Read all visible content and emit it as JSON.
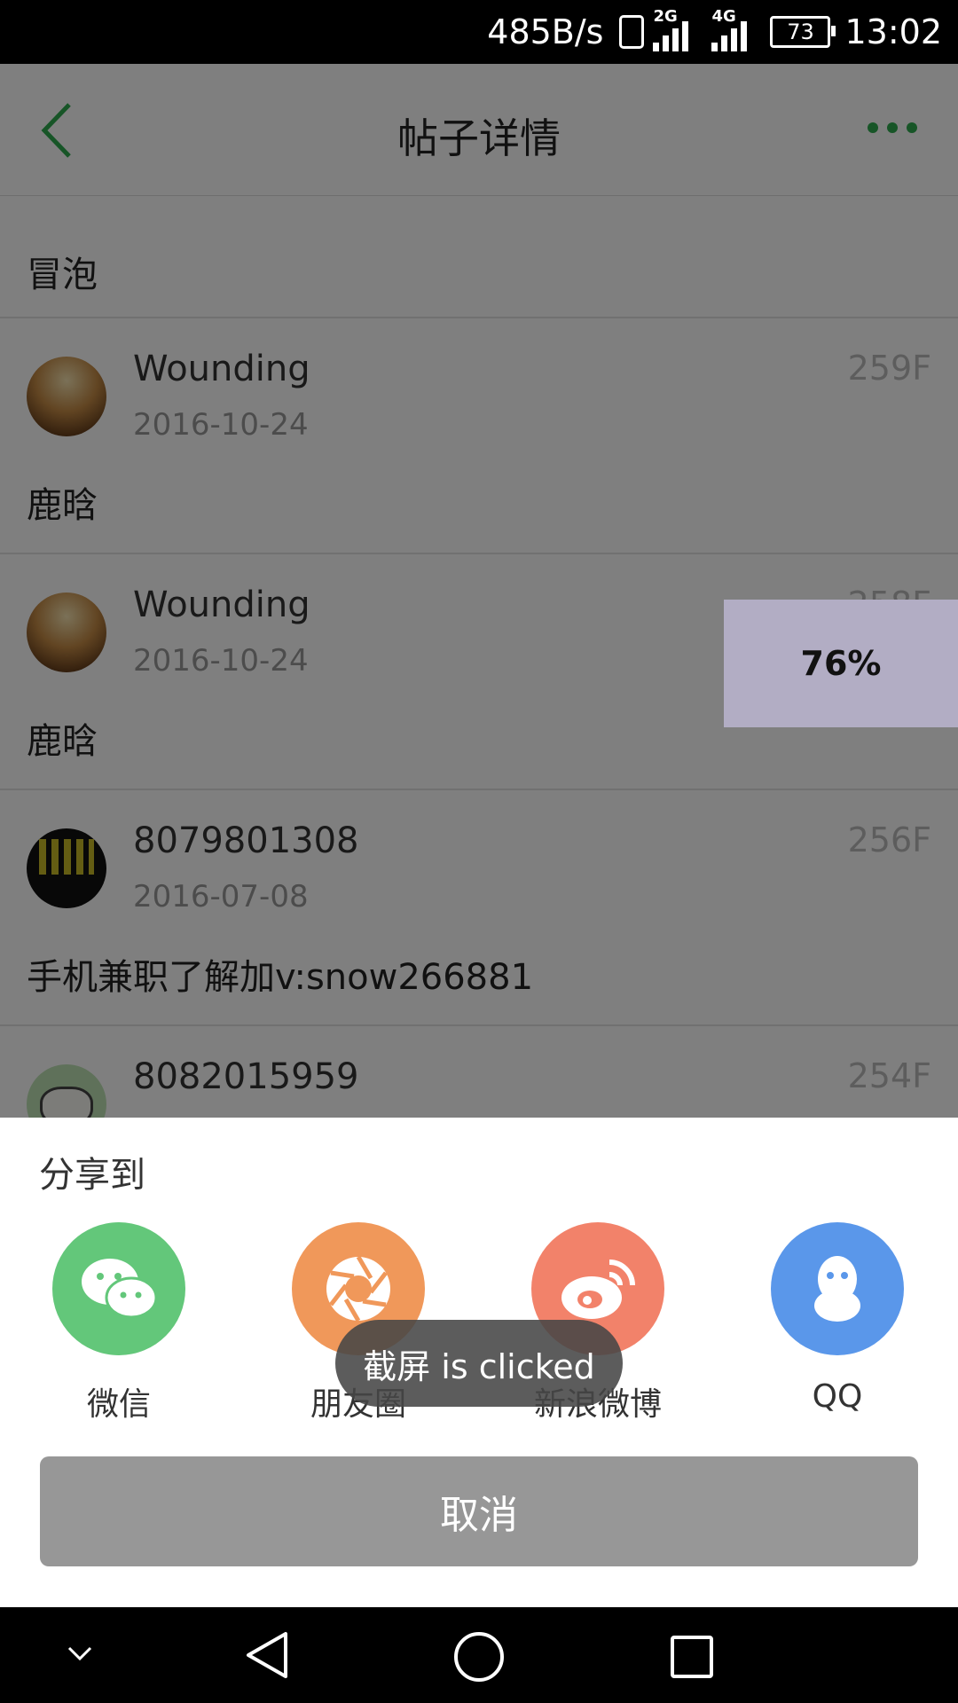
{
  "status_bar": {
    "net_speed": "485B/s",
    "sig1_label": "2G",
    "sig2_label": "4G",
    "battery": "73",
    "time": "13:02"
  },
  "header": {
    "title": "帖子详情"
  },
  "posts": [
    {
      "content": "冒泡"
    },
    {
      "username": "Wounding",
      "date": "2016-10-24",
      "floor": "259F",
      "content": "鹿晗"
    },
    {
      "username": "Wounding",
      "date": "2016-10-24",
      "floor": "258F",
      "content": "鹿晗"
    },
    {
      "username": "8079801308",
      "date": "2016-07-08",
      "floor": "256F",
      "content": "手机兼职了解加v:snow266881"
    },
    {
      "username": "8082015959",
      "floor": "254F"
    }
  ],
  "progress": {
    "value": 76,
    "label": "76%"
  },
  "share_sheet": {
    "title": "分享到",
    "items": [
      {
        "label": "微信",
        "icon": "wechat-icon",
        "color": "#63c77a"
      },
      {
        "label": "朋友圈",
        "icon": "moments-icon",
        "color": "#f0985a"
      },
      {
        "label": "新浪微博",
        "icon": "weibo-icon",
        "color": "#f2826a"
      },
      {
        "label": "QQ",
        "icon": "qq-icon",
        "color": "#5a97ea"
      }
    ],
    "cancel_label": "取消"
  },
  "toast": {
    "message": "截屏 is clicked"
  },
  "colors": {
    "accent": "#2eaa4f",
    "overlay": "rgba(0,0,0,0.5)",
    "cancel_bg": "#979797"
  }
}
